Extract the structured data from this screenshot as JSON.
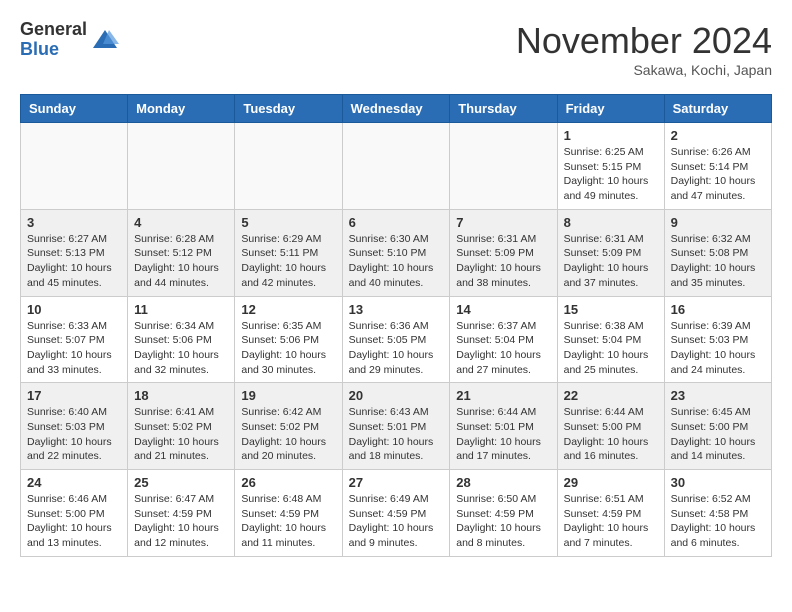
{
  "logo": {
    "general": "General",
    "blue": "Blue"
  },
  "title": "November 2024",
  "location": "Sakawa, Kochi, Japan",
  "weekdays": [
    "Sunday",
    "Monday",
    "Tuesday",
    "Wednesday",
    "Thursday",
    "Friday",
    "Saturday"
  ],
  "weeks": [
    [
      {
        "day": "",
        "info": ""
      },
      {
        "day": "",
        "info": ""
      },
      {
        "day": "",
        "info": ""
      },
      {
        "day": "",
        "info": ""
      },
      {
        "day": "",
        "info": ""
      },
      {
        "day": "1",
        "info": "Sunrise: 6:25 AM\nSunset: 5:15 PM\nDaylight: 10 hours\nand 49 minutes."
      },
      {
        "day": "2",
        "info": "Sunrise: 6:26 AM\nSunset: 5:14 PM\nDaylight: 10 hours\nand 47 minutes."
      }
    ],
    [
      {
        "day": "3",
        "info": "Sunrise: 6:27 AM\nSunset: 5:13 PM\nDaylight: 10 hours\nand 45 minutes."
      },
      {
        "day": "4",
        "info": "Sunrise: 6:28 AM\nSunset: 5:12 PM\nDaylight: 10 hours\nand 44 minutes."
      },
      {
        "day": "5",
        "info": "Sunrise: 6:29 AM\nSunset: 5:11 PM\nDaylight: 10 hours\nand 42 minutes."
      },
      {
        "day": "6",
        "info": "Sunrise: 6:30 AM\nSunset: 5:10 PM\nDaylight: 10 hours\nand 40 minutes."
      },
      {
        "day": "7",
        "info": "Sunrise: 6:31 AM\nSunset: 5:09 PM\nDaylight: 10 hours\nand 38 minutes."
      },
      {
        "day": "8",
        "info": "Sunrise: 6:31 AM\nSunset: 5:09 PM\nDaylight: 10 hours\nand 37 minutes."
      },
      {
        "day": "9",
        "info": "Sunrise: 6:32 AM\nSunset: 5:08 PM\nDaylight: 10 hours\nand 35 minutes."
      }
    ],
    [
      {
        "day": "10",
        "info": "Sunrise: 6:33 AM\nSunset: 5:07 PM\nDaylight: 10 hours\nand 33 minutes."
      },
      {
        "day": "11",
        "info": "Sunrise: 6:34 AM\nSunset: 5:06 PM\nDaylight: 10 hours\nand 32 minutes."
      },
      {
        "day": "12",
        "info": "Sunrise: 6:35 AM\nSunset: 5:06 PM\nDaylight: 10 hours\nand 30 minutes."
      },
      {
        "day": "13",
        "info": "Sunrise: 6:36 AM\nSunset: 5:05 PM\nDaylight: 10 hours\nand 29 minutes."
      },
      {
        "day": "14",
        "info": "Sunrise: 6:37 AM\nSunset: 5:04 PM\nDaylight: 10 hours\nand 27 minutes."
      },
      {
        "day": "15",
        "info": "Sunrise: 6:38 AM\nSunset: 5:04 PM\nDaylight: 10 hours\nand 25 minutes."
      },
      {
        "day": "16",
        "info": "Sunrise: 6:39 AM\nSunset: 5:03 PM\nDaylight: 10 hours\nand 24 minutes."
      }
    ],
    [
      {
        "day": "17",
        "info": "Sunrise: 6:40 AM\nSunset: 5:03 PM\nDaylight: 10 hours\nand 22 minutes."
      },
      {
        "day": "18",
        "info": "Sunrise: 6:41 AM\nSunset: 5:02 PM\nDaylight: 10 hours\nand 21 minutes."
      },
      {
        "day": "19",
        "info": "Sunrise: 6:42 AM\nSunset: 5:02 PM\nDaylight: 10 hours\nand 20 minutes."
      },
      {
        "day": "20",
        "info": "Sunrise: 6:43 AM\nSunset: 5:01 PM\nDaylight: 10 hours\nand 18 minutes."
      },
      {
        "day": "21",
        "info": "Sunrise: 6:44 AM\nSunset: 5:01 PM\nDaylight: 10 hours\nand 17 minutes."
      },
      {
        "day": "22",
        "info": "Sunrise: 6:44 AM\nSunset: 5:00 PM\nDaylight: 10 hours\nand 16 minutes."
      },
      {
        "day": "23",
        "info": "Sunrise: 6:45 AM\nSunset: 5:00 PM\nDaylight: 10 hours\nand 14 minutes."
      }
    ],
    [
      {
        "day": "24",
        "info": "Sunrise: 6:46 AM\nSunset: 5:00 PM\nDaylight: 10 hours\nand 13 minutes."
      },
      {
        "day": "25",
        "info": "Sunrise: 6:47 AM\nSunset: 4:59 PM\nDaylight: 10 hours\nand 12 minutes."
      },
      {
        "day": "26",
        "info": "Sunrise: 6:48 AM\nSunset: 4:59 PM\nDaylight: 10 hours\nand 11 minutes."
      },
      {
        "day": "27",
        "info": "Sunrise: 6:49 AM\nSunset: 4:59 PM\nDaylight: 10 hours\nand 9 minutes."
      },
      {
        "day": "28",
        "info": "Sunrise: 6:50 AM\nSunset: 4:59 PM\nDaylight: 10 hours\nand 8 minutes."
      },
      {
        "day": "29",
        "info": "Sunrise: 6:51 AM\nSunset: 4:59 PM\nDaylight: 10 hours\nand 7 minutes."
      },
      {
        "day": "30",
        "info": "Sunrise: 6:52 AM\nSunset: 4:58 PM\nDaylight: 10 hours\nand 6 minutes."
      }
    ]
  ]
}
